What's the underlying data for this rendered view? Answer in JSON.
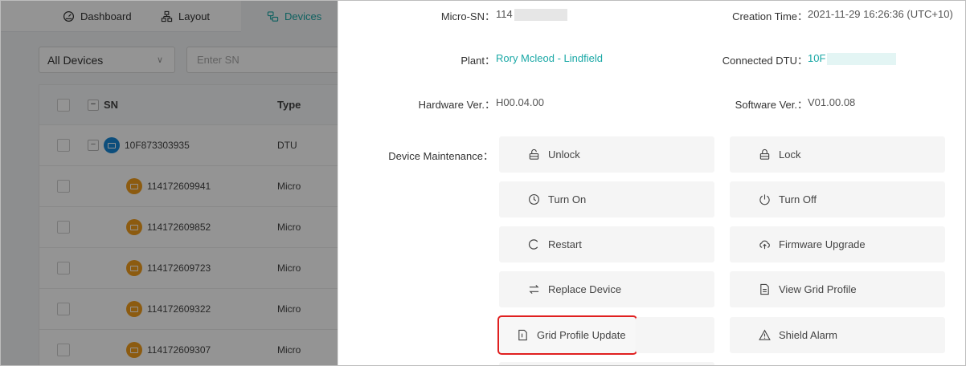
{
  "tabs": [
    {
      "label": "Dashboard",
      "icon": "dashboard-icon"
    },
    {
      "label": "Layout",
      "icon": "layout-icon"
    },
    {
      "label": "Devices",
      "icon": "devices-icon",
      "active": true
    }
  ],
  "filter": {
    "device_select": "All Devices",
    "sn_placeholder": "Enter SN"
  },
  "table": {
    "headers": {
      "sn": "SN",
      "type": "Type"
    },
    "rows": [
      {
        "sn": "10F873303935",
        "type": "DTU",
        "kind": "dtu"
      },
      {
        "sn": "114172609941",
        "type": "Micro",
        "kind": "micro"
      },
      {
        "sn": "114172609852",
        "type": "Micro",
        "kind": "micro"
      },
      {
        "sn": "114172609723",
        "type": "Micro",
        "kind": "micro"
      },
      {
        "sn": "114172609322",
        "type": "Micro",
        "kind": "micro"
      },
      {
        "sn": "114172609307",
        "type": "Micro",
        "kind": "micro"
      }
    ]
  },
  "drawer": {
    "micro_sn_label": "Micro-SN：",
    "micro_sn_value": "114",
    "creation_time_label": "Creation Time：",
    "creation_time_value": "2021-11-29 16:26:36 (UTC+10)",
    "plant_label": "Plant：",
    "plant_value": "Rory Mcleod - Lindfield",
    "connected_dtu_label": "Connected DTU：",
    "connected_dtu_value": "10F",
    "hardware_label": "Hardware Ver.：",
    "hardware_value": "H00.04.00",
    "software_label": "Software Ver.：",
    "software_value": "V01.00.08",
    "maintenance_label": "Device Maintenance：",
    "buttons": {
      "unlock": "Unlock",
      "lock": "Lock",
      "turn_on": "Turn On",
      "turn_off": "Turn Off",
      "restart": "Restart",
      "firmware_upgrade": "Firmware Upgrade",
      "replace_device": "Replace Device",
      "view_grid_profile": "View Grid Profile",
      "grid_profile_update": "Grid Profile Update",
      "shield_alarm": "Shield Alarm"
    }
  },
  "colors": {
    "accent": "#1aa8a6",
    "highlight": "#e02020",
    "dtu_icon": "#1787d6",
    "micro_icon": "#f29d1c"
  }
}
